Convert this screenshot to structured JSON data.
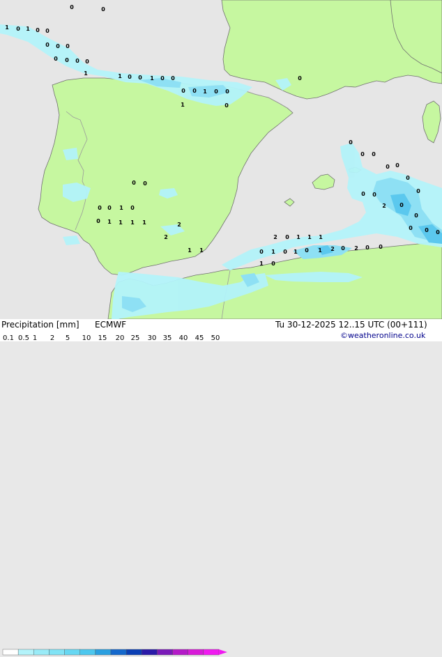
{
  "colors": {
    "sea": "#e6e6e6",
    "land": "#c6f7a0",
    "border": "#9a9a9a",
    "coast": "#707070",
    "precip_light": "#b3f3fa",
    "precip_mid": "#8ee0f4",
    "precip_heavy": "#5bc8ee"
  },
  "map": {
    "values": [
      "0",
      "0",
      "1",
      "0",
      "1",
      "0",
      "0",
      "0",
      "0",
      "0",
      "0",
      "0",
      "0",
      "0",
      "1",
      "1",
      "0",
      "0",
      "1",
      "0",
      "0",
      "0",
      "0",
      "1",
      "0",
      "0",
      "1",
      "0",
      "0",
      "0",
      "0",
      "0",
      "0",
      "0",
      "0",
      "0",
      "0",
      "0",
      "2",
      "0",
      "0",
      "0",
      "0",
      "0",
      "0",
      "0",
      "0",
      "0",
      "1",
      "0",
      "0",
      "1",
      "1",
      "1",
      "1",
      "2",
      "2",
      "1",
      "1",
      "2",
      "0",
      "1",
      "1",
      "1",
      "2",
      "0",
      "2",
      "0",
      "0",
      "0",
      "1",
      "0",
      "1",
      "0",
      "1",
      "1",
      "0",
      "0"
    ]
  },
  "legend": {
    "title": "Precipitation [mm]",
    "model": "ECMWF",
    "valid_time": "Tu 30-12-2025 12..15 UTC (00+111)",
    "credit": "©weatheronline.co.uk",
    "ticks": [
      "0.1",
      "0.5",
      "1",
      "2",
      "5",
      "10",
      "15",
      "20",
      "25",
      "30",
      "35",
      "40",
      "45",
      "50"
    ],
    "colors": [
      "#ffffff",
      "#b3f3fa",
      "#99ebf7",
      "#80e3f5",
      "#66d7f2",
      "#4cc7ee",
      "#2a9fe0",
      "#1468cc",
      "#0a3fb4",
      "#2a1aa8",
      "#7a1ab8",
      "#b41ac8",
      "#d81ad8",
      "#f01af0"
    ]
  }
}
